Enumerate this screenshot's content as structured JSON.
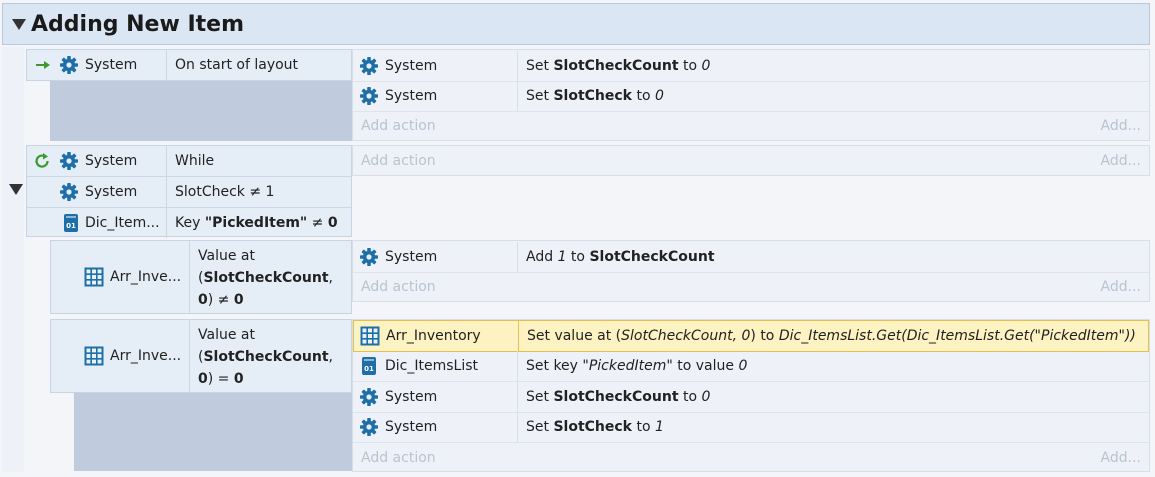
{
  "group": {
    "title": "Adding New Item"
  },
  "events": {
    "e1": {
      "cond1": {
        "obj": "System",
        "text": "On start of layout"
      },
      "actions": [
        {
          "obj": "System",
          "pre": "Set ",
          "bold": "SlotCheckCount",
          "mid": " to ",
          "ital": "0"
        },
        {
          "obj": "System",
          "pre": "Set ",
          "bold": "SlotCheck",
          "mid": " to ",
          "ital": "0"
        }
      ]
    },
    "e2": {
      "conds": [
        {
          "obj": "System",
          "text": "While"
        },
        {
          "obj": "System",
          "text": "SlotCheck ≠ 1"
        },
        {
          "obj": "Dic_Item...",
          "pre": "Key ",
          "bold": "\"PickedItem\"",
          "post": " ≠ ",
          "bold2": "0"
        }
      ]
    },
    "e3": {
      "cond": {
        "obj": "Arr_Inve...",
        "l1": "Value at",
        "l2pre": "(",
        "l2bold": "SlotCheckCount",
        "l2post": ",",
        "l3bold": "0",
        "l3mid": ") ≠ ",
        "l3bold2": "0"
      },
      "actions": [
        {
          "obj": "System",
          "pre": "Add ",
          "ital": "1",
          "mid": " to ",
          "bold": "SlotCheckCount"
        }
      ]
    },
    "e4": {
      "cond": {
        "obj": "Arr_Inve...",
        "l1": "Value at",
        "l2pre": "(",
        "l2bold": "SlotCheckCount",
        "l2post": ",",
        "l3bold": "0",
        "l3mid": ") = ",
        "l3bold2": "0"
      },
      "actions": [
        {
          "obj": "Arr_Inventory",
          "pre": "Set value at (",
          "ital": "SlotCheckCount, 0",
          "mid": ") to ",
          "ital2": "Dic_ItemsList.Get(Dic_ItemsList.Get(\"PickedItem\"))"
        },
        {
          "obj": "Dic_ItemsList",
          "pre": "Set key ",
          "ital": "\"PickedItem\"",
          "mid": " to value ",
          "ital2": "0"
        },
        {
          "obj": "System",
          "pre": "Set ",
          "bold": "SlotCheckCount",
          "mid": " to ",
          "ital": "0"
        },
        {
          "obj": "System",
          "pre": "Set ",
          "bold": "SlotCheck",
          "mid": " to ",
          "ital": "1"
        }
      ]
    }
  },
  "labels": {
    "add_action": "Add action",
    "add_more": "Add..."
  },
  "colors": {
    "accent": "#1e6fa8",
    "selected": "#fdf2c2",
    "trigger_arrow": "#3a9a2f"
  }
}
